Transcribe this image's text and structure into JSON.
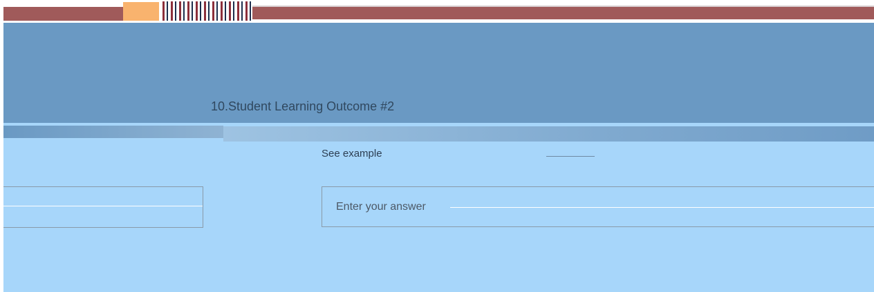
{
  "header": {
    "top_left_text": "",
    "top_center_text": "",
    "top_right_text": ""
  },
  "question": {
    "number_title": "10.Student Learning Outcome #2",
    "left_label": "",
    "description": "",
    "subtext": "See example"
  },
  "inputs": {
    "left": {
      "placeholder": "",
      "value": ""
    },
    "right": {
      "placeholder": "Enter your answer",
      "value": ""
    }
  },
  "colors": {
    "header_band": "#6a99c3",
    "question_bg": "#a7d6fa",
    "accent_maroon": "#a05a5a",
    "accent_orange": "#f9b36e"
  }
}
